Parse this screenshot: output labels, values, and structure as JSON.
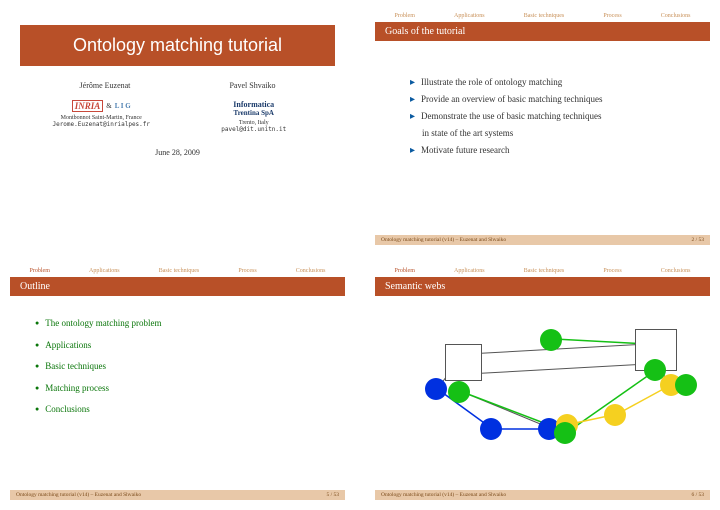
{
  "nav_items": [
    "Problem",
    "Applications",
    "Basic techniques",
    "Process",
    "Conclusions"
  ],
  "slide1": {
    "title": "Ontology matching tutorial",
    "author1": "Jérôme Euzenat",
    "author2": "Pavel Shvaiko",
    "affil1_line1": "Montbonnot Saint-Martin, France",
    "affil1_line2": "Jerome.Euzenat@inrialpes.fr",
    "affil2_line1": "Trento, Italy",
    "affil2_line2": "pavel@dit.unitn.it",
    "logo_inria": "INRIA",
    "logo_lig": "L I G",
    "logo_it1": "Informatica",
    "logo_it2": "Trentina SpA",
    "date": "June 28, 2009"
  },
  "slide2": {
    "title": "Goals of the tutorial",
    "goals": [
      "Illustrate the role of ontology matching",
      "Provide an overview of basic matching techniques",
      "Demonstrate the use of basic matching techniques",
      "in state of the art systems",
      "Motivate future research"
    ],
    "page": "2 / 53"
  },
  "slide3": {
    "title": "Outline",
    "items": [
      "The ontology matching problem",
      "Applications",
      "Basic techniques",
      "Matching process",
      "Conclusions"
    ],
    "page": "5 / 53"
  },
  "slide4": {
    "title": "Semantic webs",
    "page": "6 / 53"
  },
  "footer_text": "Ontology matching tutorial (v14) – Euzenat and Shvaiko"
}
